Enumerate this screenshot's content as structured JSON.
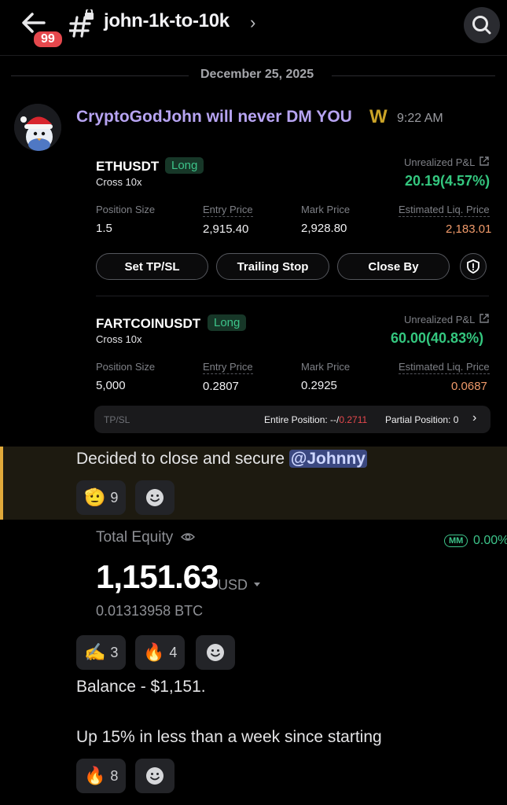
{
  "header": {
    "unread_badge": "99",
    "channel_name": "john-1k-to-10k",
    "chevron": "›"
  },
  "date_divider": "December 25, 2025",
  "message": {
    "author": "CryptoGodJohn will never DM YOU",
    "author_badge": "W",
    "time": "9:22 AM"
  },
  "positions": [
    {
      "symbol": "ETHUSDT",
      "side": "Long",
      "margin": "Cross 10x",
      "pnl_label": "Unrealized P&L",
      "pnl": "20.19(4.57%)",
      "position_size_label": "Position Size",
      "position_size": "1.5",
      "entry_price_label": "Entry Price",
      "entry_price": "2,915.40",
      "mark_price_label": "Mark Price",
      "mark_price": "2,928.80",
      "liq_label": "Estimated Liq. Price",
      "liq_price": "2,183.01",
      "buttons": [
        "Set TP/SL",
        "Trailing Stop",
        "Close By"
      ]
    },
    {
      "symbol": "FARTCOINUSDT",
      "side": "Long",
      "margin": "Cross 10x",
      "pnl_label": "Unrealized P&L",
      "pnl": "60.00(40.83%)",
      "position_size_label": "Position Size",
      "position_size": "5,000",
      "entry_price_label": "Entry Price",
      "entry_price": "0.2807",
      "mark_price_label": "Mark Price",
      "mark_price": "0.2925",
      "liq_label": "Estimated Liq. Price",
      "liq_price": "0.0687"
    }
  ],
  "tpsl_bar": {
    "label": "TP/SL",
    "entire_label": "Entire Position: --/",
    "entire_value": "0.2711",
    "partial": "Partial Position: 0",
    "chevron": "›"
  },
  "highlight": {
    "text": "Decided to close and secure",
    "mention": "@Johnny",
    "reactions": [
      {
        "emoji": "🫡",
        "count": "9"
      }
    ]
  },
  "equity": {
    "label": "Total Equity",
    "value": "1,151.63",
    "currency": "USD",
    "btc": "0.01313958 BTC",
    "mm_tag": "MM",
    "mm_value": "0.00%"
  },
  "reactions_2": [
    {
      "emoji": "✍️",
      "count": "3"
    },
    {
      "emoji": "🔥",
      "count": "4"
    }
  ],
  "message_2": {
    "line1": "Balance - $1,151.",
    "line2": "Up 15% in less than a week since starting"
  },
  "reactions_3": [
    {
      "emoji": "🔥",
      "count": "8"
    }
  ],
  "colors": {
    "accent_green": "#34c77f",
    "author_purple": "#b7a4f2",
    "liq_orange": "#f09a6a",
    "highlight_bar": "#e0a93a",
    "badge_red": "#e5484d"
  }
}
